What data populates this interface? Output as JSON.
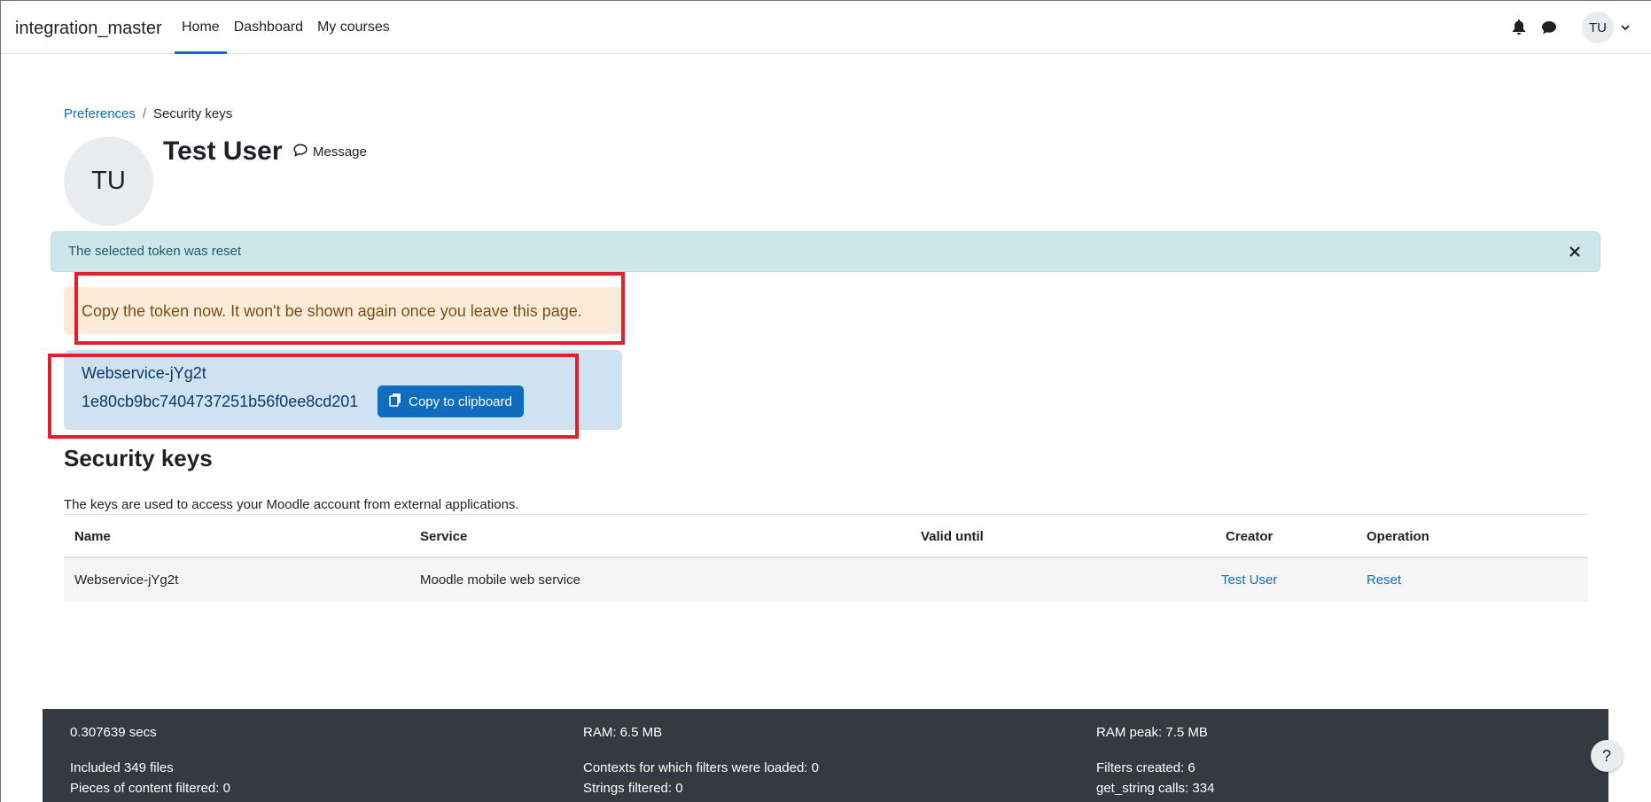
{
  "navbar": {
    "brand": "integration_master",
    "links": [
      {
        "label": "Home",
        "active": true
      },
      {
        "label": "Dashboard",
        "active": false
      },
      {
        "label": "My courses",
        "active": false
      }
    ],
    "user_initials": "TU",
    "icons": {
      "notifications": "bell-icon",
      "messages": "chat-bubble-icon",
      "user_menu": "chevron-down-icon"
    }
  },
  "breadcrumb": {
    "items": [
      "Preferences",
      "Security keys"
    ],
    "separator": "/"
  },
  "profile": {
    "initials": "TU",
    "name": "Test User",
    "message_label": "Message"
  },
  "alerts": {
    "info": "The selected token was reset",
    "warning": "Copy the token now. It won't be shown again once you leave this page."
  },
  "token": {
    "name": "Webservice-jYg2t",
    "value": "1e80cb9bc7404737251b56f0ee8cd201",
    "copy_label": "Copy to clipboard"
  },
  "security_keys": {
    "title": "Security keys",
    "description": "The keys are used to access your Moodle account from external applications.",
    "columns": [
      "Name",
      "Service",
      "Valid until",
      "Creator",
      "Operation"
    ],
    "rows": [
      {
        "name": "Webservice-jYg2t",
        "service": "Moodle mobile web service",
        "valid_until": "",
        "creator": "Test User",
        "operation": "Reset"
      }
    ]
  },
  "footer": {
    "col1": [
      "0.307639 secs",
      "Included 349 files",
      "Pieces of content filtered: 0"
    ],
    "col2": [
      "RAM: 6.5 MB",
      "Contexts for which filters were loaded: 0",
      "Strings filtered: 0"
    ],
    "col3": [
      "RAM peak: 7.5 MB",
      "Filters created: 6",
      "get_string calls: 334"
    ]
  },
  "help_label": "?",
  "colors": {
    "primary": "#0f6cbf",
    "highlight": "#e0202e",
    "footer_bg": "#343a40"
  }
}
